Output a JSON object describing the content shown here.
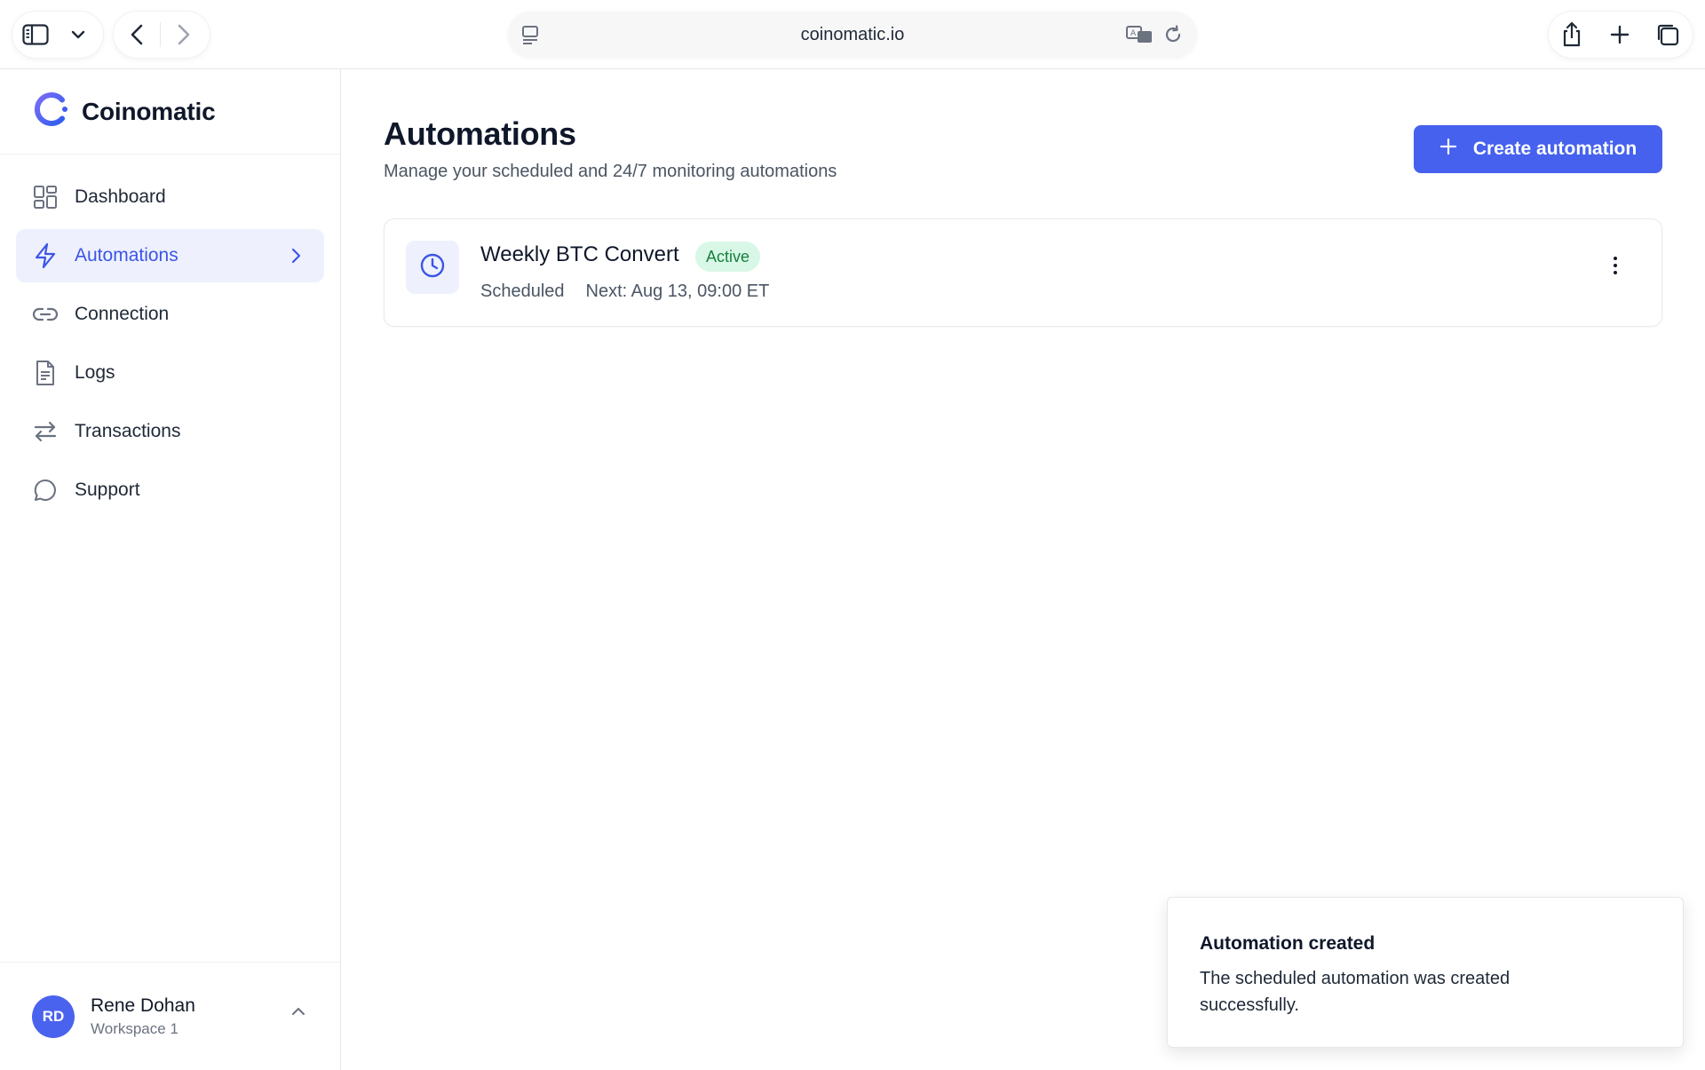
{
  "browser": {
    "url": "coinomatic.io"
  },
  "sidebar": {
    "brand": "Coinomatic",
    "items": [
      {
        "label": "Dashboard",
        "icon": "dashboard-grid-icon",
        "active": false
      },
      {
        "label": "Automations",
        "icon": "lightning-bolt-icon",
        "active": true
      },
      {
        "label": "Connection",
        "icon": "link-icon",
        "active": false
      },
      {
        "label": "Logs",
        "icon": "document-icon",
        "active": false
      },
      {
        "label": "Transactions",
        "icon": "swap-arrows-icon",
        "active": false
      },
      {
        "label": "Support",
        "icon": "chat-bubble-icon",
        "active": false
      }
    ],
    "user": {
      "initials": "RD",
      "name": "Rene Dohan",
      "workspace": "Workspace 1"
    }
  },
  "main": {
    "title": "Automations",
    "subtitle": "Manage your scheduled and 24/7 monitoring automations",
    "create_label": "Create automation",
    "automations": [
      {
        "name": "Weekly BTC Convert",
        "status": "Active",
        "type": "Scheduled",
        "next": "Next: Aug 13, 09:00 ET",
        "icon": "clock-icon"
      }
    ]
  },
  "toast": {
    "title": "Automation created",
    "body": "The scheduled automation was created successfully."
  },
  "colors": {
    "accent": "#4561ee",
    "active_nav_bg": "#eef1fd",
    "badge_bg": "#d9f7e6",
    "badge_text": "#15803d"
  }
}
